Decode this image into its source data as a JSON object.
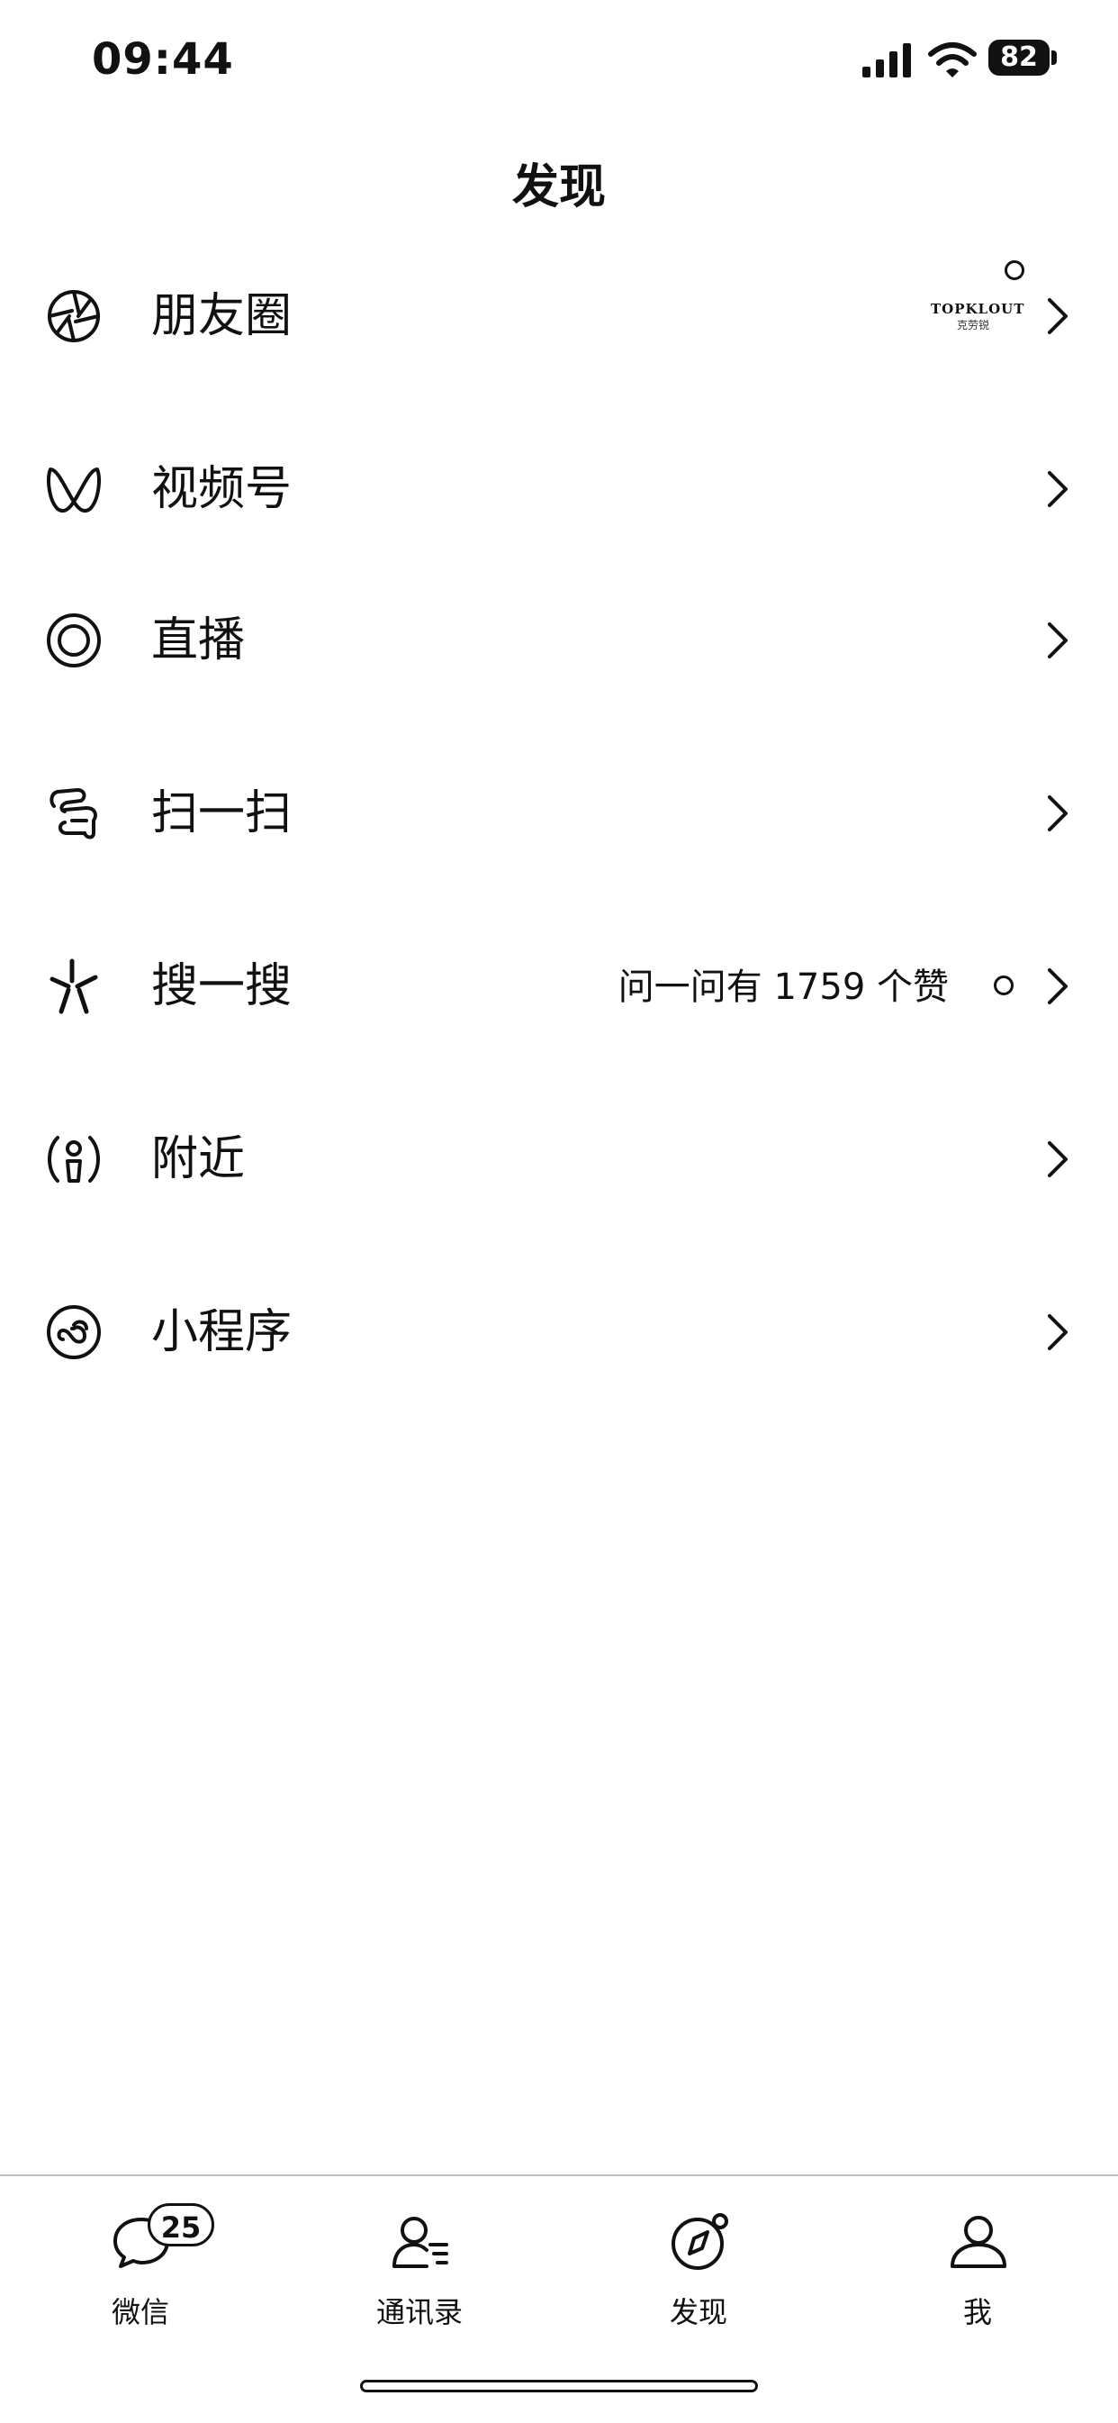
{
  "status_bar": {
    "time": "09:44",
    "battery": "82"
  },
  "header": {
    "title": "发现"
  },
  "rows": [
    {
      "label": "朋友圈",
      "icon": "moments-icon",
      "thumb_brand": "TOPKLOUT",
      "thumb_sub": "克劳锐"
    },
    {
      "label": "视频号",
      "icon": "channels-icon"
    },
    {
      "label": "直播",
      "icon": "live-icon"
    },
    {
      "label": "扫一扫",
      "icon": "scan-icon"
    },
    {
      "label": "搜一搜",
      "icon": "search-icon",
      "extra": "问一问有 1759 个赞"
    },
    {
      "label": "附近",
      "icon": "nearby-icon"
    },
    {
      "label": "小程序",
      "icon": "mini-program-icon"
    }
  ],
  "tabbar": {
    "tabs": [
      {
        "label": "微信",
        "icon": "chat-icon",
        "badge": "25"
      },
      {
        "label": "通讯录",
        "icon": "contacts-icon"
      },
      {
        "label": "发现",
        "icon": "compass-icon"
      },
      {
        "label": "我",
        "icon": "me-icon"
      }
    ]
  }
}
